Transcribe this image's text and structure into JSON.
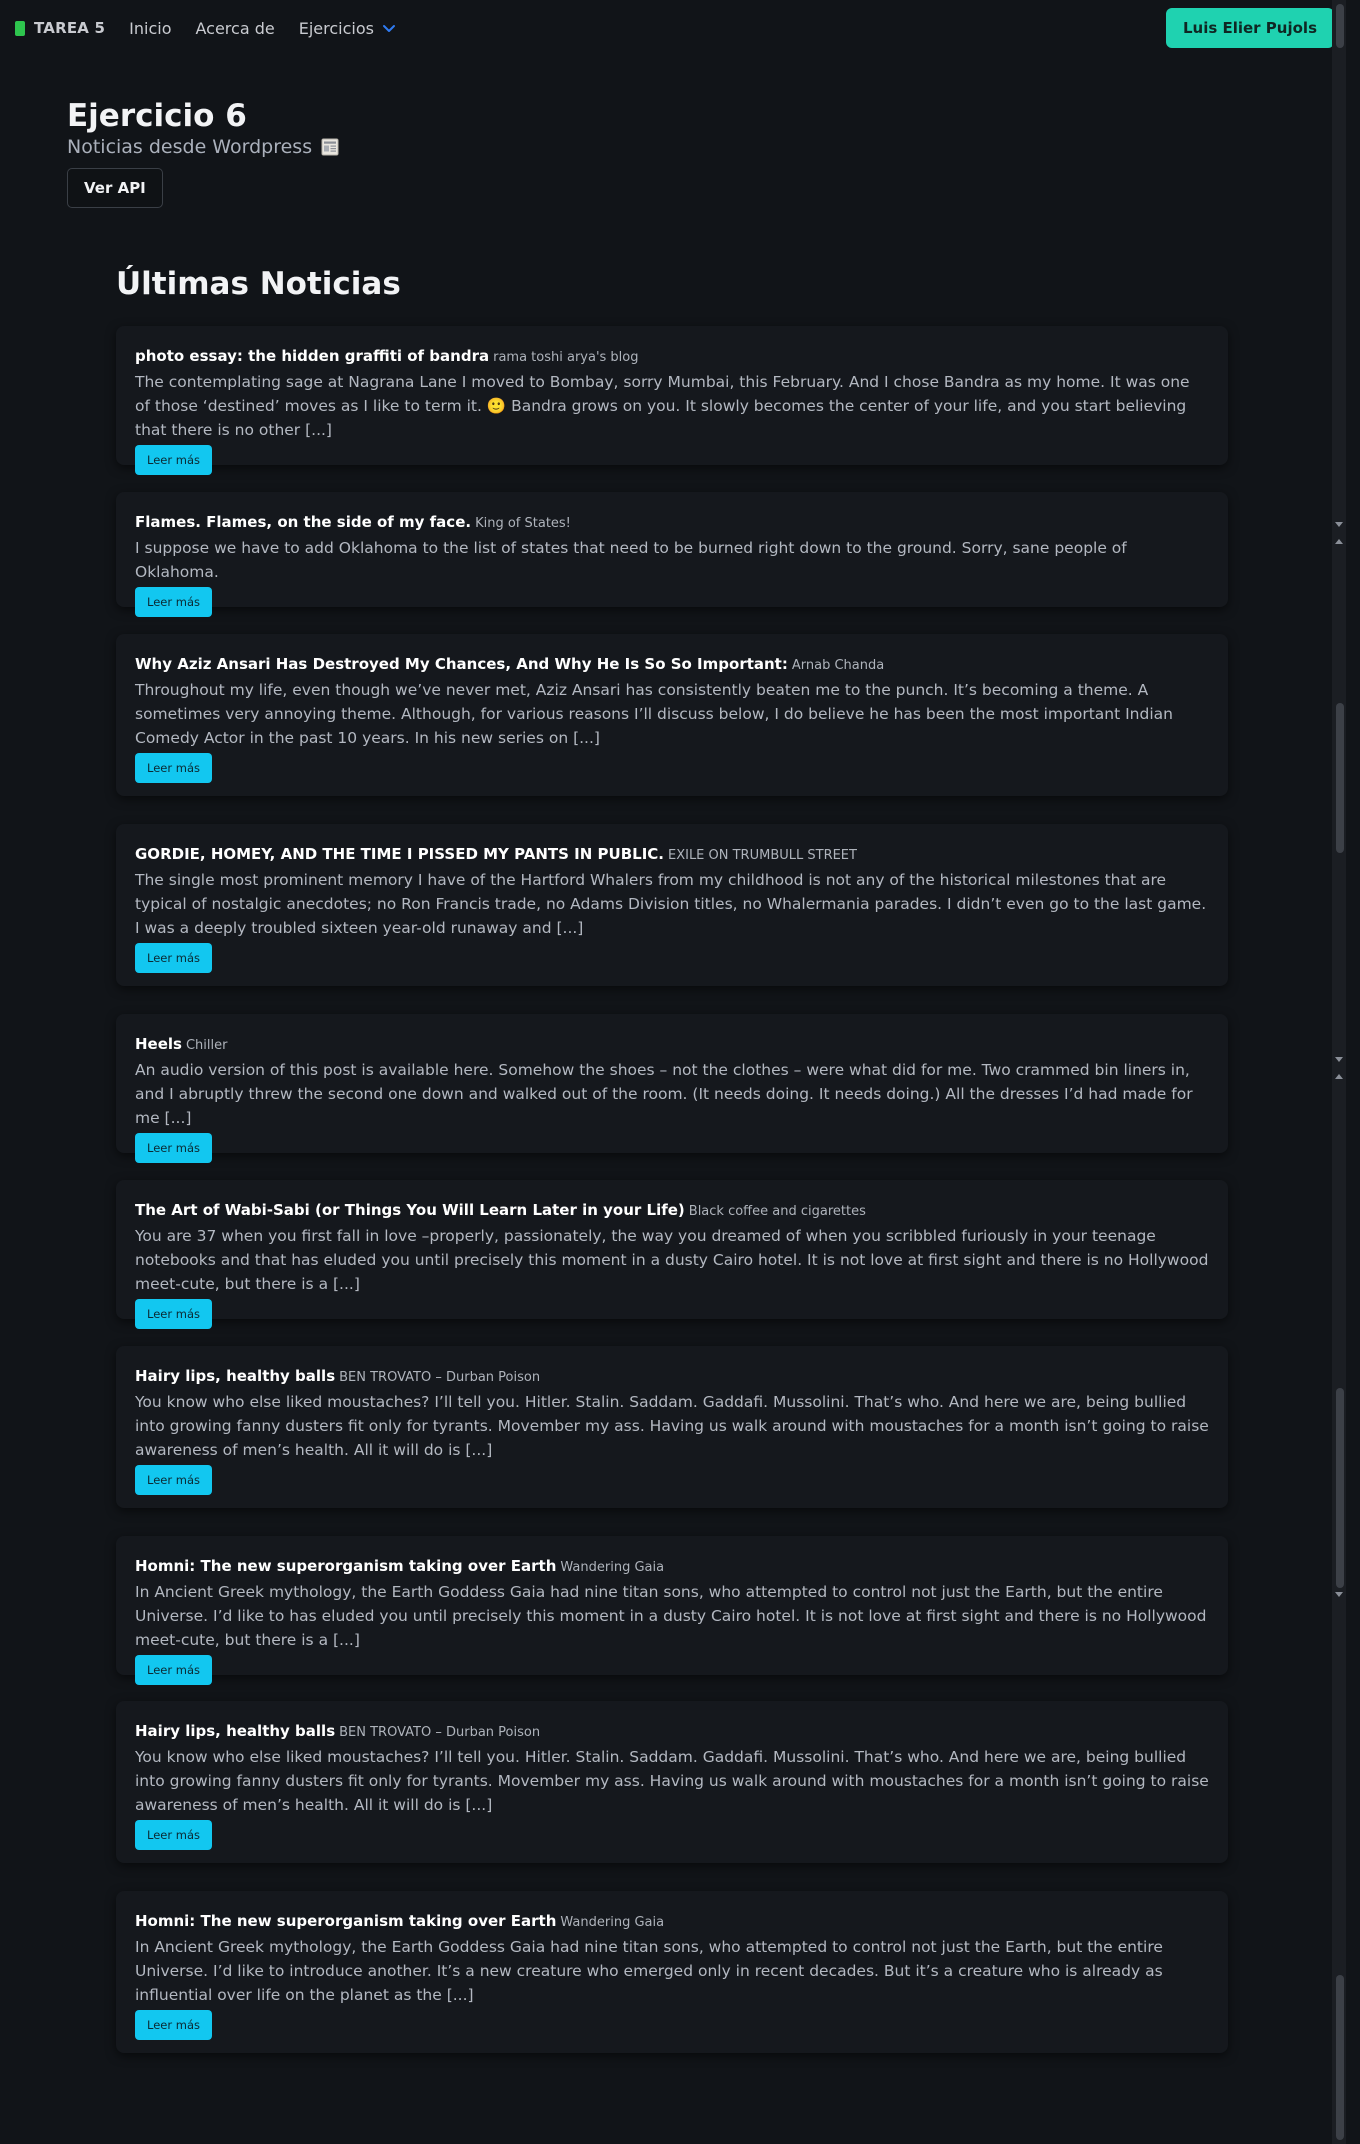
{
  "nav": {
    "brand": "TAREA 5",
    "links": [
      "Inicio",
      "Acerca de"
    ],
    "dropdown": "Ejercicios",
    "user_button": "Luis Elier Pujols"
  },
  "header": {
    "title": "Ejercicio 6",
    "subtitle": "Noticias desde Wordpress",
    "api_button": "Ver API"
  },
  "section_title": "Últimas Noticias",
  "read_more_label": "Leer más",
  "colors": {
    "background": "#111418",
    "card": "#15181d",
    "accent_user": "#1fd2b0",
    "accent_read": "#12c7f0",
    "brand_icon": "#2ec54e"
  },
  "news": [
    {
      "title": "photo essay: the hidden graffiti of bandra",
      "source": "rama toshi arya's blog",
      "excerpt": "The contemplating sage at Nagrana Lane I moved to Bombay, sorry Mumbai, this February. And I chose Bandra as my home. It was one of those ‘destined’ moves as I like to term it. 🙂 Bandra grows on you. It slowly becomes the center of your life, and you start believing that there is no other [...]"
    },
    {
      "title": "Flames. Flames, on the side of my face.",
      "source": "King of States!",
      "excerpt": "I suppose we have to add Oklahoma to the list of states that need to be burned right down to the ground. Sorry, sane people of Oklahoma."
    },
    {
      "title": "Why Aziz Ansari Has Destroyed My Chances, And Why He Is So So Important:",
      "source": "Arnab Chanda",
      "excerpt": "Throughout my life, even though we’ve never met, Aziz Ansari has consistently beaten me to the punch. It’s becoming a theme. A sometimes very annoying theme. Although, for various reasons I’ll discuss below, I do believe he has been the most important Indian Comedy Actor in the past 10 years. In his new series on [...]"
    },
    {
      "title": "GORDIE, HOMEY, AND THE TIME I PISSED MY PANTS IN PUBLIC.",
      "source": "EXILE ON TRUMBULL STREET",
      "excerpt": "The single most prominent memory I have of the Hartford Whalers from my childhood is not any of the historical milestones that are typical of nostalgic anecdotes; no Ron Francis trade, no Adams Division titles, no Whalermania parades. I didn’t even go to the last game. I was a deeply troubled sixteen year-old runaway and [...]"
    },
    {
      "title": "Heels",
      "source": "Chiller",
      "excerpt": "An audio version of this post is available here. Somehow the shoes – not the clothes – were what did for me. Two crammed bin liners in, and I abruptly threw the second one down and walked out of the room. (It needs doing. It needs doing.) All the dresses I’d had made for me [...]"
    },
    {
      "title": "The Art of Wabi-Sabi (or Things You Will Learn Later in your Life)",
      "source": "Black coffee and cigarettes",
      "excerpt": "You are 37 when you first fall in love –properly, passionately, the way you dreamed of when you scribbled furiously in your teenage notebooks and that has eluded you until precisely this moment in a dusty Cairo hotel. It is not love at first sight and there is no Hollywood meet-cute, but there is a [...]"
    },
    {
      "title": "Hairy lips, healthy balls",
      "source": "BEN TROVATO – Durban Poison",
      "excerpt": "You know who else liked moustaches? I’ll tell you. Hitler. Stalin. Saddam. Gaddafi. Mussolini. That’s who. And here we are, being bullied into growing fanny dusters fit only for tyrants. Movember my ass. Having us walk around with moustaches for a month isn’t going to raise awareness of men’s health. All it will do is [...]"
    },
    {
      "title": "Homni: The new superorganism taking over Earth",
      "source": "Wandering Gaia",
      "excerpt": "In Ancient Greek mythology, the Earth Goddess Gaia had nine titan sons, who attempted to control not just the Earth, but the entire Universe. I’d like to has eluded you until precisely this moment in a dusty Cairo hotel. It is not love at first sight and there is no Hollywood meet-cute, but there is a [...]"
    },
    {
      "title": "Hairy lips, healthy balls",
      "source": "BEN TROVATO – Durban Poison",
      "excerpt": "You know who else liked moustaches? I’ll tell you. Hitler. Stalin. Saddam. Gaddafi. Mussolini. That’s who. And here we are, being bullied into growing fanny dusters fit only for tyrants. Movember my ass. Having us walk around with moustaches for a month isn’t going to raise awareness of men’s health. All it will do is [...]"
    },
    {
      "title": "Homni: The new superorganism taking over Earth",
      "source": "Wandering Gaia",
      "excerpt": "In Ancient Greek mythology, the Earth Goddess Gaia had nine titan sons, who attempted to control not just the Earth, but the entire Universe. I’d like to introduce another. It’s a new creature who emerged only in recent decades. But it’s a creature who is already as influential over life on the planet as the [...]"
    }
  ]
}
